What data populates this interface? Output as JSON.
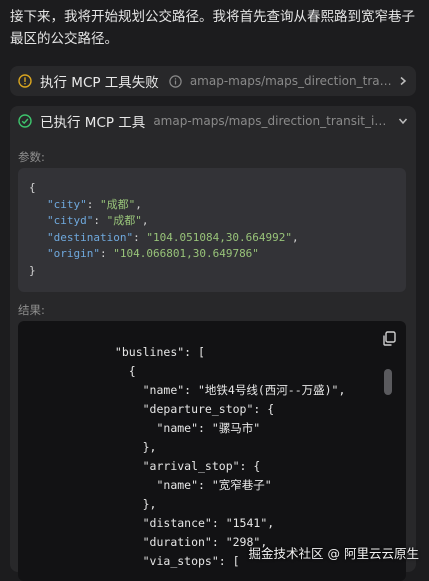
{
  "intro_text": "接下来，我将开始规划公交路径。我将首先查询从春熙路到宽窄巷子最区的公交路径。",
  "card_failed": {
    "title": "执行 MCP 工具失败",
    "tool": "amap-maps/maps_direction_transit_integrated",
    "status_color": "#d9a520"
  },
  "card_success": {
    "title": "已执行 MCP 工具",
    "tool": "amap-maps/maps_direction_transit_integrated",
    "status_color": "#3ec46d",
    "params_label": "参数:",
    "params": {
      "open": "{",
      "close": "}",
      "lines": [
        {
          "key": "\"city\"",
          "value": "\"成都\"",
          "sep": ","
        },
        {
          "key": "\"cityd\"",
          "value": "\"成都\"",
          "sep": ","
        },
        {
          "key": "\"destination\"",
          "value": "\"104.051084,30.664992\"",
          "sep": ","
        },
        {
          "key": "\"origin\"",
          "value": "\"104.066801,30.649786\"",
          "sep": ""
        }
      ]
    },
    "result_label": "结果:",
    "result_text": "              \"buslines\": [\n                {\n                  \"name\": \"地铁4号线(西河--万盛)\",\n                  \"departure_stop\": {\n                    \"name\": \"骡马市\"\n                  },\n                  \"arrival_stop\": {\n                    \"name\": \"宽窄巷子\"\n                  },\n                  \"distance\": \"1541\",\n                  \"duration\": \"298\",\n                  \"via_stops\": ["
  },
  "watermark": "掘金技术社区 @ 阿里云云原生"
}
